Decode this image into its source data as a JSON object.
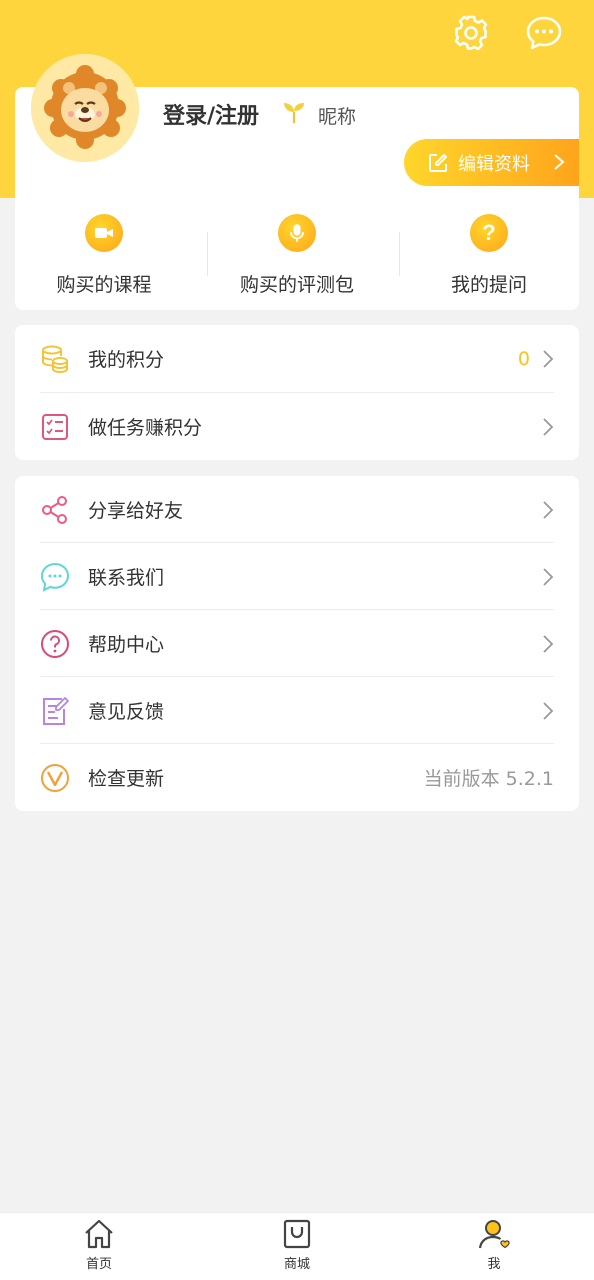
{
  "header": {
    "settings_icon": "gear-icon",
    "message_icon": "chat-bubble-icon"
  },
  "profile": {
    "login_label": "登录/注册",
    "nickname": "昵称",
    "edit_label": "编辑资料"
  },
  "quick_actions": [
    {
      "label": "购买的课程",
      "icon": "video-camera-icon"
    },
    {
      "label": "购买的评测包",
      "icon": "microphone-icon"
    },
    {
      "label": "我的提问",
      "icon": "question-icon"
    }
  ],
  "points_menu": [
    {
      "label": "我的积分",
      "value": "0",
      "icon": "coins-icon"
    },
    {
      "label": "做任务赚积分",
      "icon": "task-list-icon"
    }
  ],
  "settings_menu": [
    {
      "label": "分享给好友",
      "icon": "share-icon"
    },
    {
      "label": "联系我们",
      "icon": "chat-icon"
    },
    {
      "label": "帮助中心",
      "icon": "help-icon"
    },
    {
      "label": "意见反馈",
      "icon": "feedback-icon"
    },
    {
      "label": "检查更新",
      "value": "当前版本 5.2.1",
      "icon": "update-icon"
    }
  ],
  "bottom_nav": [
    {
      "label": "首页",
      "icon": "home-icon"
    },
    {
      "label": "商城",
      "icon": "shop-bag-icon"
    },
    {
      "label": "我",
      "icon": "profile-icon"
    }
  ],
  "colors": {
    "brand_yellow": "#ffd53d",
    "accent_orange": "#ffa41b",
    "points_value": "#ffc21a"
  }
}
